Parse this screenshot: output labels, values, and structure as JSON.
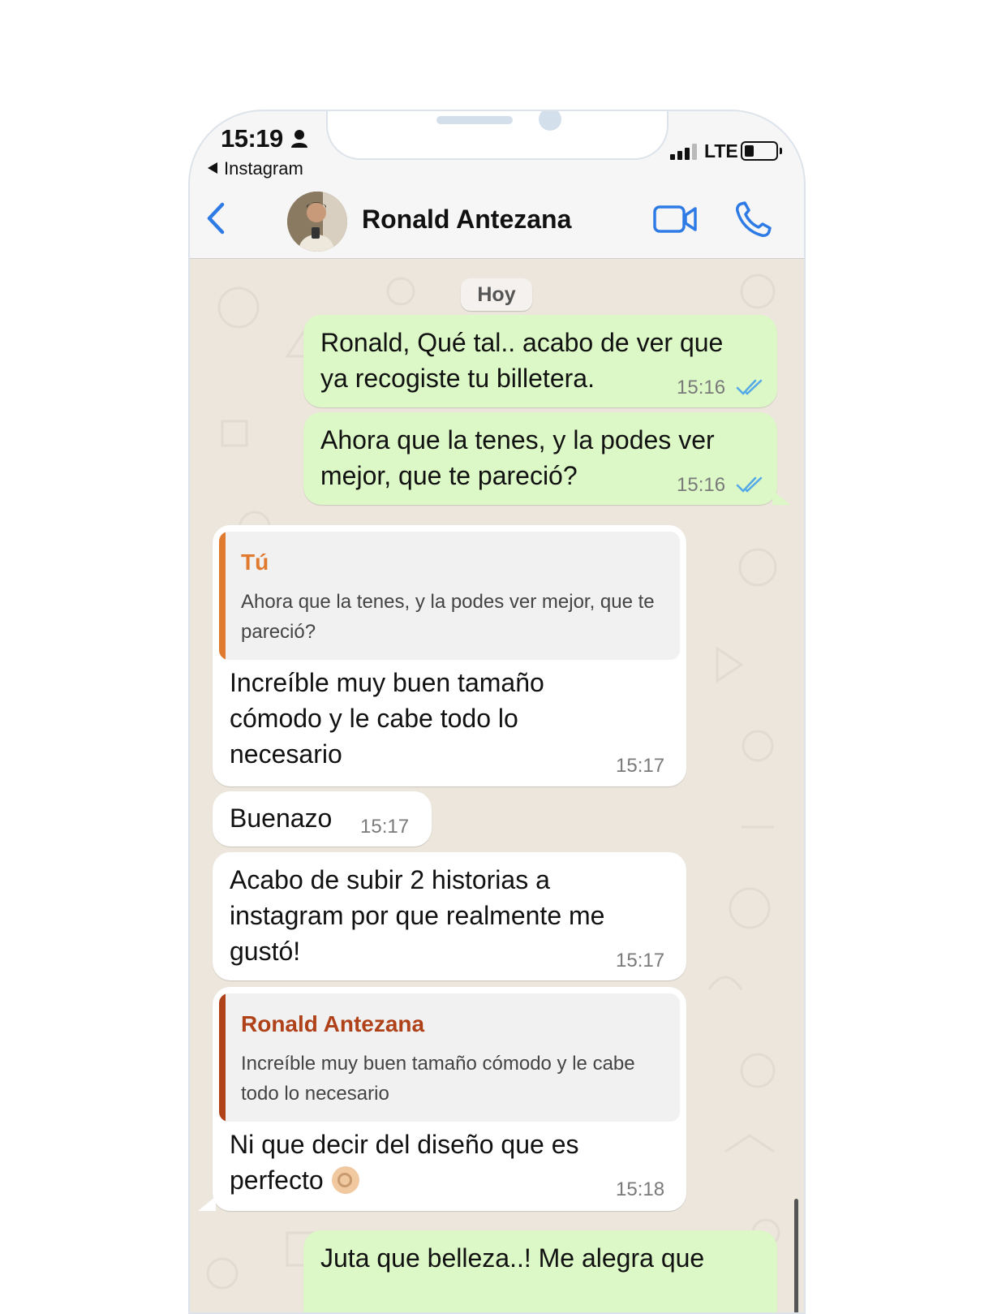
{
  "status_bar": {
    "time": "15:19",
    "back_app": "Instagram",
    "network": "LTE"
  },
  "header": {
    "contact_name": "Ronald Antezana"
  },
  "date_separator": "Hoy",
  "messages": [
    {
      "direction": "out",
      "text_line1": "Ronald, Qué tal.. acabo de ver que",
      "text_line2": "ya recogiste tu billetera.",
      "time": "15:16"
    },
    {
      "direction": "out",
      "text_line1": "Ahora que la tenes, y la podes ver",
      "text_line2": "mejor, que te pareció?",
      "time": "15:16"
    },
    {
      "direction": "in",
      "quote_author": "Tú",
      "quote_text": "Ahora que la tenes, y la podes ver mejor, que te pareció?",
      "text_line1": "Increíble muy buen tamaño",
      "text_line2": "cómodo y le cabe todo lo",
      "text_line3": "necesario",
      "time": "15:17"
    },
    {
      "direction": "in",
      "text_line1": "Buenazo",
      "time": "15:17"
    },
    {
      "direction": "in",
      "text_line1": "Acabo de subir 2 historias a",
      "text_line2": "instagram por que realmente me",
      "text_line3": "gustó!",
      "time": "15:17"
    },
    {
      "direction": "in",
      "quote_author": "Ronald Antezana",
      "quote_text": "Increíble muy buen tamaño cómodo y le cabe todo lo necesario",
      "text_line1": "Ni que decir del diseño que es",
      "text_line2": "perfecto",
      "emoji": "ok-hand",
      "time": "15:18"
    },
    {
      "direction": "out",
      "text_line1": "Juta que belleza..! Me alegra que"
    }
  ],
  "colors": {
    "outgoing_bubble": "#dcf8c6",
    "incoming_bubble": "#ffffff",
    "accent_blue": "#2f7be5",
    "quote_you": "#e07a2e",
    "quote_contact": "#b0421a",
    "read_ticks": "#53a9e8"
  }
}
